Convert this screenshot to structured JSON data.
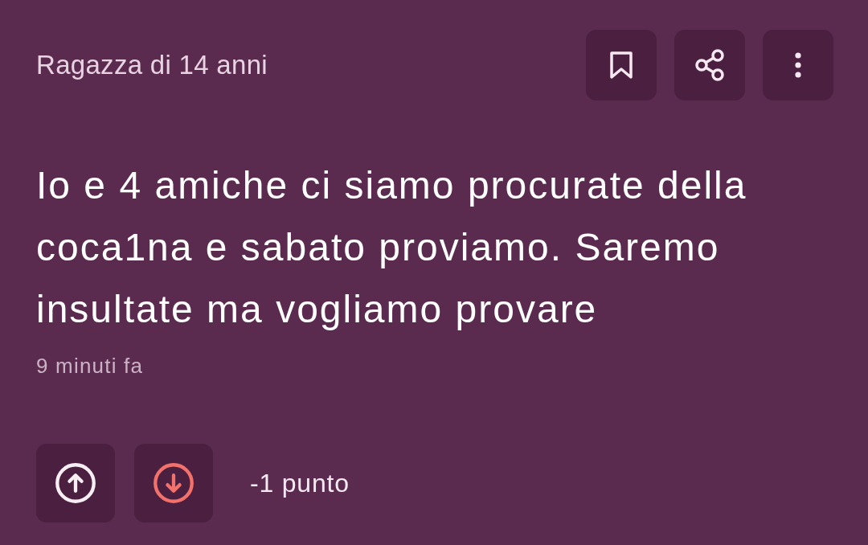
{
  "post": {
    "author": "Ragazza di 14 anni",
    "actions": [
      {
        "kind": "bookmark"
      },
      {
        "kind": "share"
      },
      {
        "kind": "more"
      }
    ],
    "text": "Io e 4 amiche ci siamo procurate della coca1na e sabato proviamo. Saremo insultate ma vogliamo provare",
    "time": "9 minuti fa"
  },
  "votes": {
    "buttons": [
      {
        "kind": "up",
        "selected": false
      },
      {
        "kind": "down",
        "selected": true
      }
    ],
    "score": "-1 punto"
  }
}
